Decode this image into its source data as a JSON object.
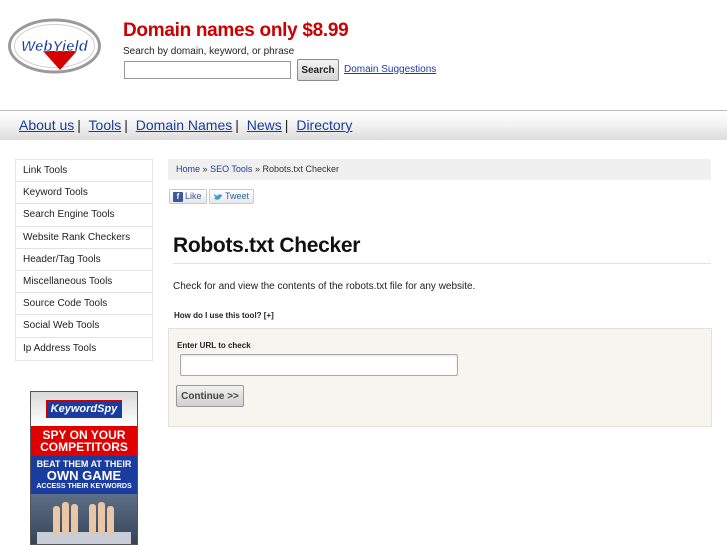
{
  "header": {
    "logo_text": "WebYield",
    "promo_title": "Domain names only $8.99",
    "promo_subtitle": "Search by domain, keyword, or phrase",
    "search_input": {
      "value": "",
      "placeholder": ""
    },
    "search_button_label": "Search",
    "suggestions_link": "Domain Suggestions"
  },
  "nav": {
    "items": [
      {
        "label": "About us"
      },
      {
        "label": "Tools"
      },
      {
        "label": "Domain Names"
      },
      {
        "label": "News"
      },
      {
        "label": "Directory"
      }
    ],
    "separator": "|"
  },
  "sidebar": {
    "items": [
      {
        "label": "Link Tools"
      },
      {
        "label": "Keyword Tools"
      },
      {
        "label": "Search Engine Tools"
      },
      {
        "label": "Website Rank Checkers"
      },
      {
        "label": "Header/Tag Tools"
      },
      {
        "label": "Miscellaneous Tools"
      },
      {
        "label": "Source Code Tools"
      },
      {
        "label": "Social Web Tools"
      },
      {
        "label": "Ip Address Tools"
      }
    ]
  },
  "ad": {
    "brand": "KeywordSpy",
    "line1": "SPY ON YOUR",
    "line2": "COMPETITORS",
    "line3": "BEAT THEM AT THEIR",
    "line4": "OWN GAME",
    "line5": "ACCESS THEIR KEYWORDS"
  },
  "breadcrumb": {
    "home": "Home",
    "sep1": "»",
    "section": "SEO Tools",
    "sep2": "»",
    "current": "Robots.txt Checker"
  },
  "social": {
    "like_label": "Like",
    "tweet_label": "Tweet"
  },
  "main": {
    "title": "Robots.txt Checker",
    "description": "Check for and view the contents of the robots.txt file for any website.",
    "howto": "How do I use this tool? [+]",
    "url_label": "Enter URL to check",
    "url_input": {
      "value": "",
      "placeholder": ""
    },
    "continue_label": "Continue >>"
  },
  "colors": {
    "accent_red": "#cc0000",
    "link_blue": "#1a3c9e"
  }
}
